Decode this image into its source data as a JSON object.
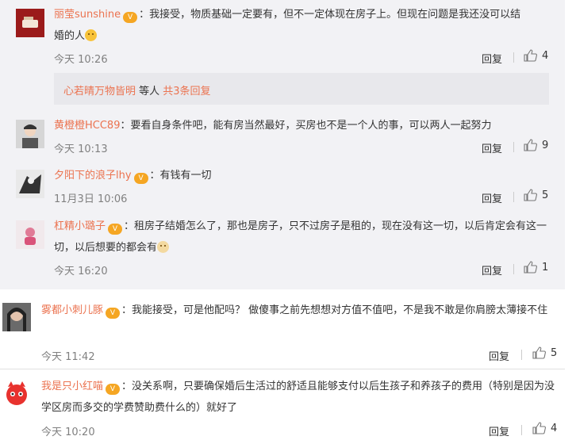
{
  "comments": [
    {
      "name": "丽莹sunshine",
      "text": "：我接受，物质基础一定要有，但不一定体现在房子上。但现在问题是我还没可以结婚的人",
      "emoji": "laugh-cry-emoji",
      "time": "今天 10:26",
      "reply_label": "回复",
      "likes": "4"
    },
    {
      "name": "黄橙橙HCC89",
      "text": "：要看自身条件吧，能有房当然最好，买房也不是一个人的事，可以两人一起努力",
      "time": "今天 10:13",
      "reply_label": "回复",
      "likes": "9"
    },
    {
      "name": "夕阳下的浪子lhy",
      "text": "：有钱有一切",
      "time": "11月3日 10:06",
      "reply_label": "回复",
      "likes": "5"
    },
    {
      "name": "杠精小璐子",
      "text": "：租房子结婚怎么了，那也是房子，只不过房子是租的，现在没有这一切，以后肯定会有这一切，以后想要的都会有",
      "emoji": "doge-emoji",
      "time": "今天 16:20",
      "reply_label": "回复",
      "likes": "1"
    },
    {
      "name": "雾都小刺儿豚",
      "text": "：我能接受，可是他配吗？ 做傻事之前先想想对方值不值吧，不是我不敢是你肩膀太薄接不住",
      "time": "今天 11:42",
      "reply_label": "回复",
      "likes": "5"
    },
    {
      "name": "我是只小红喵",
      "text": "：没关系啊，只要确保婚后生活过的舒适且能够支付以后生孩子和养孩子的费用（特别是因为没学区房而多交的学费赞助费什么的）就好了",
      "time": "今天 10:20",
      "reply_label": "回复",
      "likes": "4"
    }
  ],
  "reply_summary": {
    "users": "心若晴万物皆明",
    "middle": " 等人 ",
    "count_link": "共3条回复"
  },
  "colors": {
    "name": "#eb7350",
    "meta": "#808080",
    "panel": "#f2f2f5",
    "vip": "#f5a623"
  }
}
